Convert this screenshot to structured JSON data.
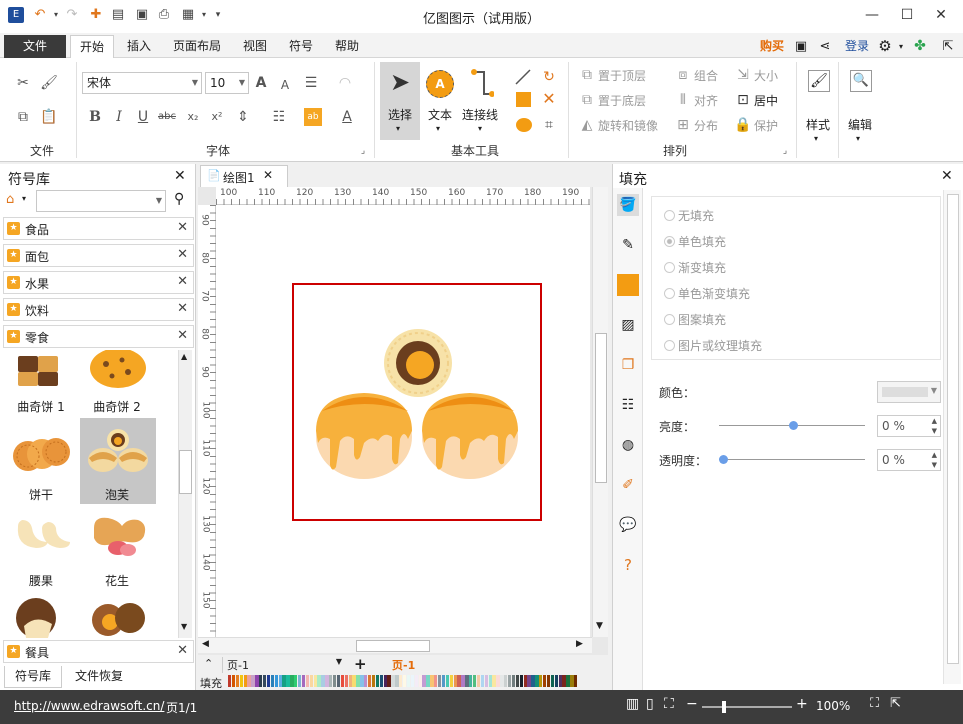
{
  "app": {
    "title": "亿图图示（试用版）"
  },
  "tabs": {
    "file": "文件",
    "home": "开始",
    "insert": "插入",
    "page_layout": "页面布局",
    "view": "视图",
    "symbol": "符号",
    "help": "帮助"
  },
  "top_right": {
    "buy": "购买",
    "login": "登录"
  },
  "ribbon": {
    "group_file": "文件",
    "group_font": "字体",
    "group_basic_tools": "基本工具",
    "group_arrange": "排列",
    "font_name": "宋体",
    "font_size": "10",
    "select": "选择",
    "text": "文本",
    "connector": "连接线",
    "bring_front": "置于顶层",
    "send_back": "置于底层",
    "rotate_mirror": "旋转和镜像",
    "group": "组合",
    "align": "对齐",
    "distribute": "分布",
    "size": "大小",
    "center": "居中",
    "protect": "保护",
    "style": "样式",
    "edit": "编辑"
  },
  "library": {
    "title": "符号库",
    "categories": [
      "食品",
      "面包",
      "水果",
      "饮料",
      "零食"
    ],
    "shapes": [
      "曲奇饼 1",
      "曲奇饼 2",
      "饼干",
      "泡芙",
      "腰果",
      "花生"
    ],
    "bottom_category": "餐具",
    "bottom_tabs": [
      "符号库",
      "文件恢复"
    ]
  },
  "document": {
    "tab": "绘图1",
    "ruler_top": [
      "100",
      "110",
      "120",
      "130",
      "140",
      "150",
      "160",
      "170",
      "180",
      "190"
    ],
    "ruler_left": [
      "90",
      "80",
      "70",
      "80",
      "90",
      "100",
      "110",
      "120",
      "130",
      "140",
      "150"
    ]
  },
  "pages": {
    "select": "页-1",
    "active": "页-1",
    "fill_label": "填充"
  },
  "fill_panel": {
    "title": "填充",
    "options": [
      "无填充",
      "单色填充",
      "渐变填充",
      "单色渐变填充",
      "图案填充",
      "图片或纹理填充"
    ],
    "color_label": "颜色：",
    "brightness_label": "亮度：",
    "brightness_value": "0 %",
    "transparency_label": "透明度：",
    "transparency_value": "0 %"
  },
  "status": {
    "url": "http://www.edrawsoft.cn/",
    "page": "页1/1",
    "zoom": "100%"
  },
  "colors": {
    "accent": "#e46c0a",
    "selection": "#cc0000",
    "orange": "#f39c12"
  }
}
